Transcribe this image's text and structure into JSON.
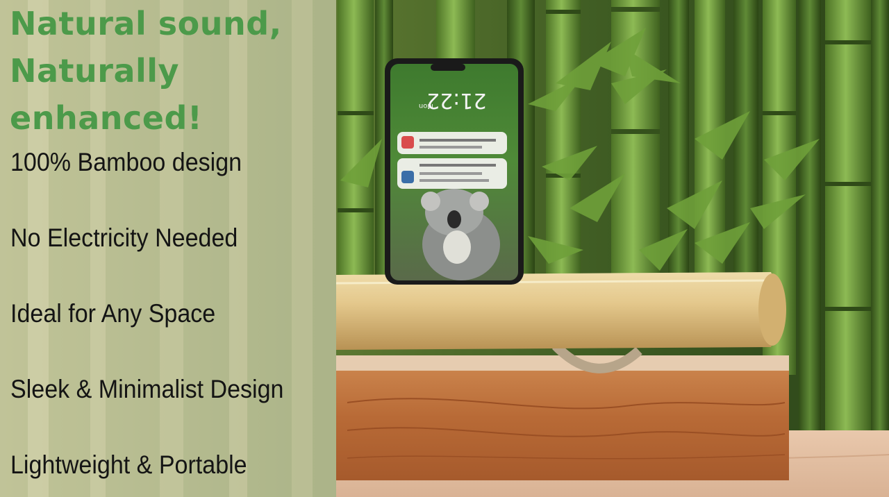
{
  "headline": {
    "line1": "Natural sound,",
    "line2": "Naturally",
    "line3": "enhanced!"
  },
  "features": [
    "100% Bamboo design",
    "No Electricity Needed",
    "Ideal for Any Space",
    "Sleek & Minimalist Design",
    "Lightweight & Portable"
  ],
  "phone": {
    "time": "21:22",
    "weekday": "Mon"
  },
  "colors": {
    "headline": "#4c9a4a",
    "feature_text": "#141414",
    "bamboo_green": "#6f9a3c",
    "wood": "#b86a36"
  }
}
